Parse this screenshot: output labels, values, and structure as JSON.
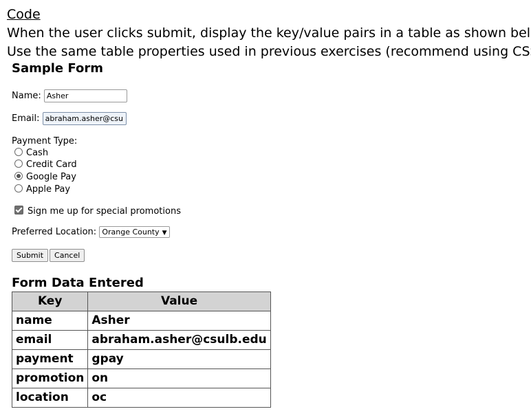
{
  "intro": {
    "heading": "Code",
    "line1": "When the user clicks submit, display the key/value pairs in a table as shown below.",
    "line2": "Use the same table properties used in previous exercises (recommend using CSS)."
  },
  "form": {
    "title": "Sample Form",
    "name_label": "Name:",
    "name_value": "Asher",
    "email_label": "Email:",
    "email_value": "abraham.asher@csulb.e",
    "payment_label": "Payment Type:",
    "payment_options": [
      {
        "label": "Cash",
        "selected": false
      },
      {
        "label": "Credit Card",
        "selected": false
      },
      {
        "label": "Google Pay",
        "selected": true
      },
      {
        "label": "Apple Pay",
        "selected": false
      }
    ],
    "promo_label": "Sign me up for special promotions",
    "promo_checked": true,
    "location_label": "Preferred Location:",
    "location_value": "Orange County",
    "submit_label": "Submit",
    "cancel_label": "Cancel"
  },
  "results": {
    "title": "Form Data Entered",
    "headers": [
      "Key",
      "Value"
    ],
    "rows": [
      [
        "name",
        "Asher"
      ],
      [
        "email",
        "abraham.asher@csulb.edu"
      ],
      [
        "payment",
        "gpay"
      ],
      [
        "promotion",
        "on"
      ],
      [
        "location",
        "oc"
      ]
    ]
  }
}
